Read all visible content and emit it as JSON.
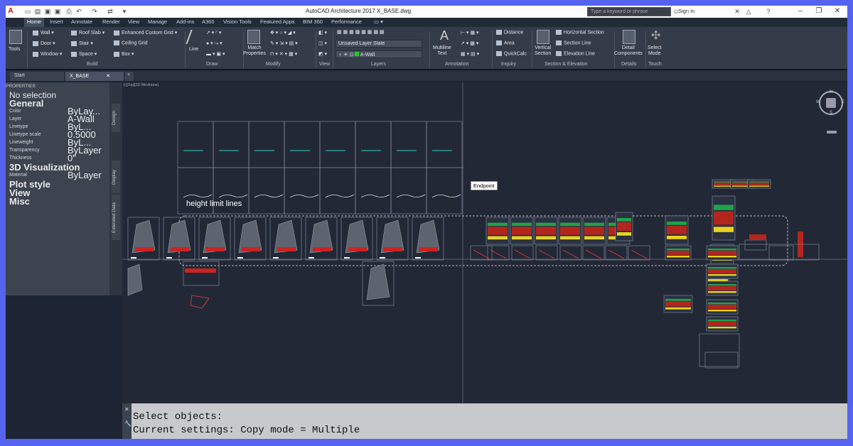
{
  "window": {
    "title": "AutoCAD Architecture 2017   X_BASE.dwg"
  },
  "search": {
    "placeholder": "Type a keyword or phrase"
  },
  "account": {
    "sign_in": "Sign In"
  },
  "ribbon_tabs": [
    "Home",
    "Insert",
    "Annotate",
    "Render",
    "View",
    "Manage",
    "Add-ins",
    "A360",
    "Vision Tools",
    "Featured Apps",
    "BIM 360",
    "Performance"
  ],
  "ribbon": {
    "tools": "Tools",
    "build": {
      "wall": "Wall",
      "door": "Door",
      "window": "Window",
      "roof_slab": "Roof Slab",
      "stair": "Stair",
      "space": "Space",
      "enhanced_grid": "Enhanced Custom Grid",
      "ceiling_grid": "Ceiling Grid",
      "box": "Box",
      "title": "Build"
    },
    "draw": {
      "line": "Line",
      "title": "Draw"
    },
    "modify": {
      "match_properties": "Match\nProperties",
      "title": "Modify"
    },
    "view": {
      "title": "View"
    },
    "layers": {
      "state": "Unsaved Layer State",
      "current": "A-Wall",
      "title": "Layers"
    },
    "annotation": {
      "mtext": "Multiline\nText",
      "title": "Annotation"
    },
    "inquiry": {
      "distance": "Distance",
      "area": "Area",
      "quickcalc": "QuickCalc",
      "title": "Inquiry"
    },
    "section": {
      "vertical": "Vertical\nSection",
      "horizontal": "Horizontal Section",
      "section_line": "Section Line",
      "elevation_line": "Elevation Line",
      "title": "Section & Elevation"
    },
    "details": {
      "components": "Detail\nComponents",
      "title": "Details"
    },
    "touch": {
      "select_mode": "Select\nMode",
      "title": "Touch"
    }
  },
  "doc_tabs": [
    "Start",
    "X_BASE"
  ],
  "properties": {
    "header": "PROPERTIES",
    "selection": "No selection",
    "general_label": "General",
    "rows": [
      {
        "name": "Color",
        "value": "ByLay..."
      },
      {
        "name": "Layer",
        "value": "A-Wall"
      },
      {
        "name": "Linetype",
        "value": "ByL..."
      },
      {
        "name": "Linetype scale",
        "value": "0.5000"
      },
      {
        "name": "Lineweight",
        "value": "ByL..."
      },
      {
        "name": "Transparency",
        "value": "ByLayer"
      },
      {
        "name": "Thickness",
        "value": "0\""
      }
    ],
    "viz_label": "3D Visualization",
    "material": {
      "name": "Material",
      "value": "ByLayer"
    },
    "plot_style": "Plot style",
    "view": "View",
    "misc": "Misc",
    "vertical_tabs": [
      "Design",
      "Display",
      "Extended Data"
    ]
  },
  "canvas": {
    "viewport_label": "[-][Top][2D Wireframe]",
    "tooltip": "Endpoint",
    "annotation": "height limit lines",
    "compass": {
      "n": "N",
      "s": "S",
      "e": "E",
      "w": "W",
      "center": "TOP"
    }
  },
  "command": {
    "line1": "Select objects:",
    "line2": "Current settings:  Copy mode = Multiple"
  },
  "colors": {
    "accent": "#5563f0",
    "canvas": "#222836"
  }
}
